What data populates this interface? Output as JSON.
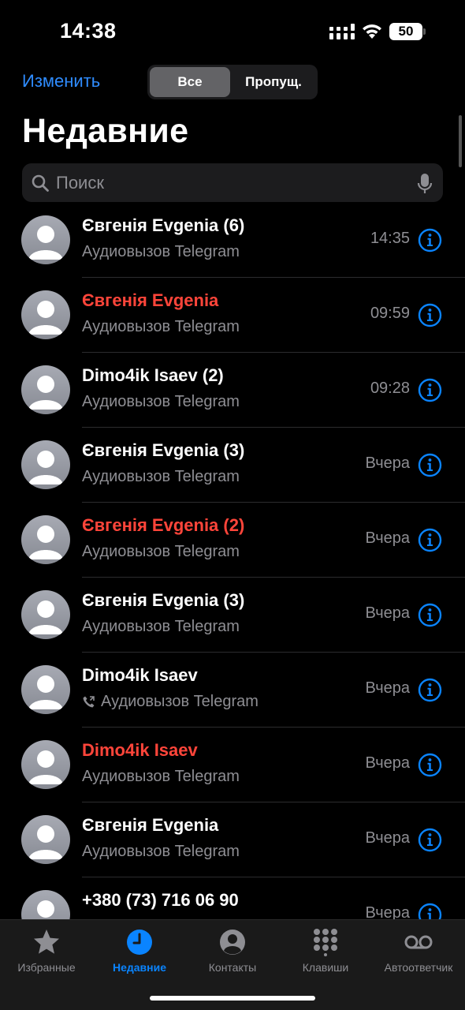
{
  "status_bar": {
    "time": "14:38",
    "battery": "50"
  },
  "header": {
    "edit_label": "Изменить",
    "segments": [
      "Все",
      "Пропущ."
    ],
    "title": "Недавние"
  },
  "search": {
    "placeholder": "Поиск"
  },
  "calls": [
    {
      "name": "Євгенія Evgenia (6)",
      "type": "Аудиовызов Telegram",
      "time": "14:35",
      "missed": false
    },
    {
      "name": "Євгенія Evgenia",
      "type": "Аудиовызов Telegram",
      "time": "09:59",
      "missed": true
    },
    {
      "name": "Dimo4ik Isaev (2)",
      "type": "Аудиовызов Telegram",
      "time": "09:28",
      "missed": false
    },
    {
      "name": "Євгенія Evgenia (3)",
      "type": "Аудиовызов Telegram",
      "time": "Вчера",
      "missed": false
    },
    {
      "name": "Євгенія Evgenia (2)",
      "type": "Аудиовызов Telegram",
      "time": "Вчера",
      "missed": true
    },
    {
      "name": "Євгенія Evgenia (3)",
      "type": "Аудиовызов Telegram",
      "time": "Вчера",
      "missed": false
    },
    {
      "name": "Dimo4ik Isaev",
      "type": "Аудиовызов Telegram",
      "time": "Вчера",
      "missed": false,
      "outgoing": true
    },
    {
      "name": "Dimo4ik Isaev",
      "type": "Аудиовызов Telegram",
      "time": "Вчера",
      "missed": true
    },
    {
      "name": "Євгенія Evgenia",
      "type": "Аудиовызов Telegram",
      "time": "Вчера",
      "missed": false
    },
    {
      "name": "+380 (73) 716 06 90",
      "type": "",
      "time": "Вчера",
      "missed": false
    }
  ],
  "tab_bar": {
    "tabs": [
      {
        "label": "Избранные",
        "icon": "star-icon"
      },
      {
        "label": "Недавние",
        "icon": "clock-icon"
      },
      {
        "label": "Контакты",
        "icon": "person-circle-icon"
      },
      {
        "label": "Клавиши",
        "icon": "keypad-icon"
      },
      {
        "label": "Автоответчик",
        "icon": "voicemail-icon"
      }
    ],
    "active": "Недавние"
  },
  "colors": {
    "accent": "#0a84ff",
    "missed": "#ff453a",
    "secondary_text": "#8e8e93"
  }
}
